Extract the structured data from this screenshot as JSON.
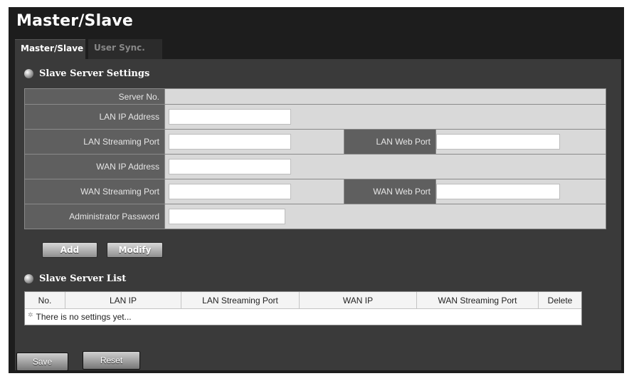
{
  "page": {
    "title": "Master/Slave"
  },
  "tabs": [
    {
      "label": "Master/Slave"
    },
    {
      "label": "User Sync."
    }
  ],
  "slave_settings": {
    "heading": "Slave Server Settings",
    "server_no_label": "Server No.",
    "server_no_value": "",
    "lan_ip_label": "LAN IP Address",
    "lan_ip_value": "",
    "lan_streaming_port_label": "LAN Streaming Port",
    "lan_streaming_port_value": "",
    "lan_web_port_label": "LAN Web Port",
    "lan_web_port_value": "",
    "wan_ip_label": "WAN IP Address",
    "wan_ip_value": "",
    "wan_streaming_port_label": "WAN Streaming Port",
    "wan_streaming_port_value": "",
    "wan_web_port_label": "WAN Web Port",
    "wan_web_port_value": "",
    "admin_password_label": "Administrator Password",
    "admin_password_value": "",
    "add_button": "Add",
    "modify_button": "Modify"
  },
  "slave_list": {
    "heading": "Slave Server List",
    "columns": [
      "No.",
      "LAN IP",
      "LAN Streaming Port",
      "WAN IP",
      "WAN Streaming Port",
      "Delete"
    ],
    "empty_message": "There is no settings yet..."
  },
  "footer": {
    "save_button": "Save",
    "reset_button": "Reset"
  }
}
